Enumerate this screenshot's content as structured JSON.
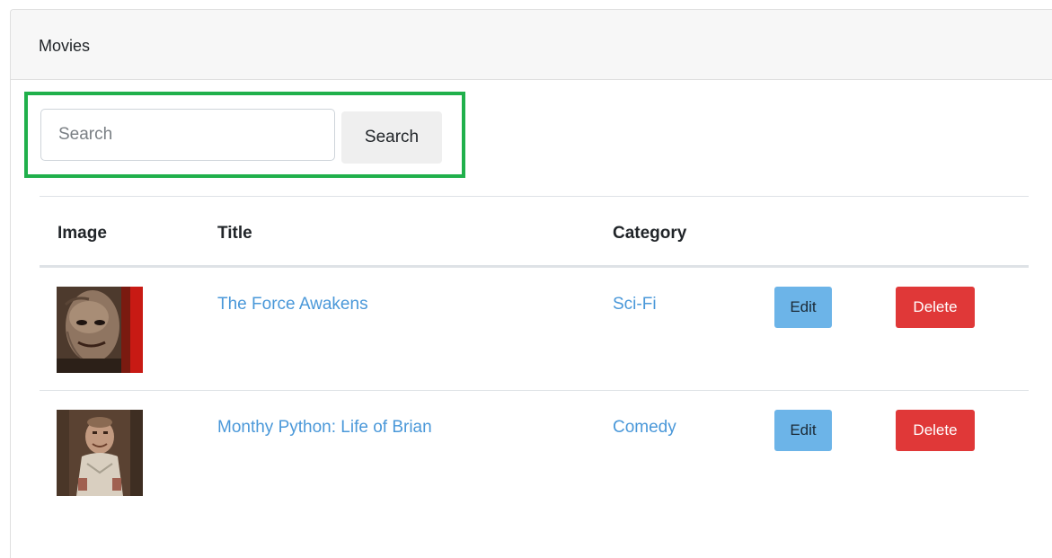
{
  "panel": {
    "title": "Movies"
  },
  "search": {
    "placeholder": "Search",
    "value": "",
    "button_label": "Search",
    "highlight_color": "#20b04b"
  },
  "table": {
    "headers": {
      "image": "Image",
      "title": "Title",
      "category": "Category"
    },
    "rows": [
      {
        "title": "The Force Awakens",
        "category": "Sci-Fi",
        "edit_label": "Edit",
        "delete_label": "Delete",
        "thumbnail": "movie-poster-thumbnail"
      },
      {
        "title": "Monthy Python: Life of Brian",
        "category": "Comedy",
        "edit_label": "Edit",
        "delete_label": "Delete",
        "thumbnail": "movie-poster-thumbnail"
      }
    ]
  },
  "colors": {
    "link": "#4a98d9",
    "edit_button": "#6cb4e8",
    "delete_button": "#e03838",
    "header_bg": "#f7f7f7"
  }
}
